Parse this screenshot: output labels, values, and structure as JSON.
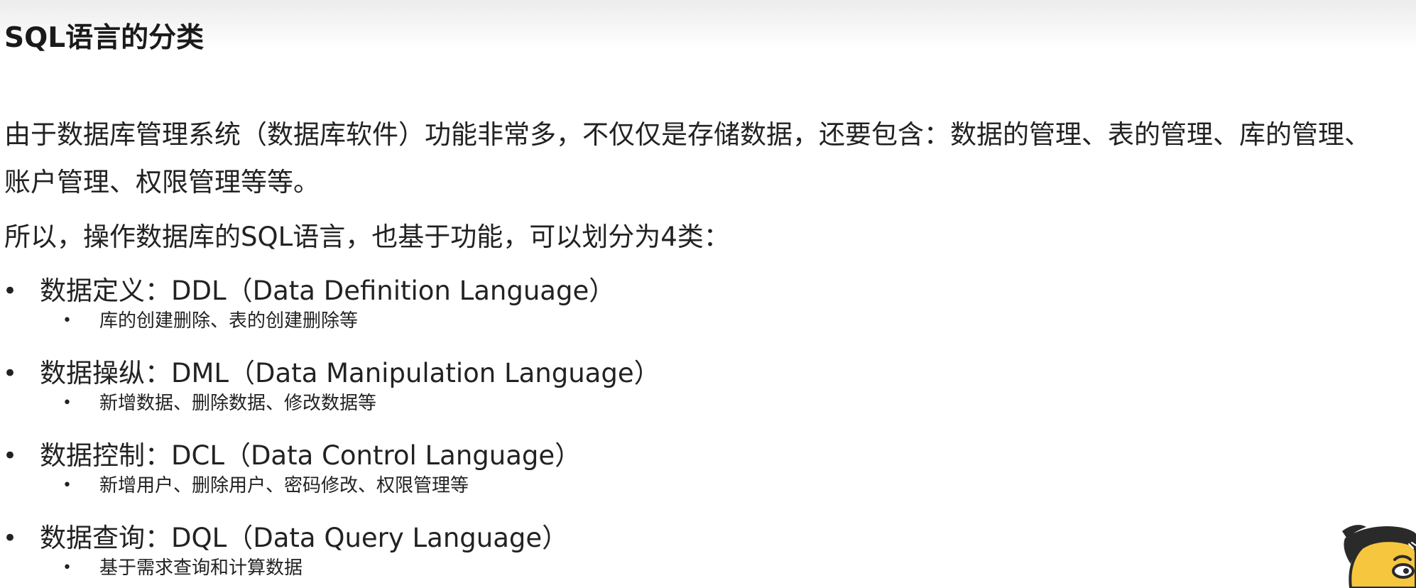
{
  "slide": {
    "title": "SQL语言的分类",
    "para1": "由于数据库管理系统（数据库软件）功能非常多，不仅仅是存储数据，还要包含：数据的管理、表的管理、库的管理、账户管理、权限管理等等。",
    "para2": "所以，操作数据库的SQL语言，也基于功能，可以划分为4类：",
    "bullet_symbol": "•",
    "categories": [
      {
        "label": "数据定义：DDL（Data Definition Language）",
        "detail": "库的创建删除、表的创建删除等"
      },
      {
        "label": "数据操纵：DML（Data Manipulation Language）",
        "detail": "新增数据、删除数据、修改数据等"
      },
      {
        "label": "数据控制：DCL（Data Control Language）",
        "detail": "新增用户、删除用户、密码修改、权限管理等"
      },
      {
        "label": "数据查询：DQL（Data Query Language）",
        "detail": "基于需求查询和计算数据"
      }
    ]
  },
  "colors": {
    "text": "#222222",
    "mascot_skin": "#f6c63f",
    "mascot_hair": "#2a2a2a"
  }
}
